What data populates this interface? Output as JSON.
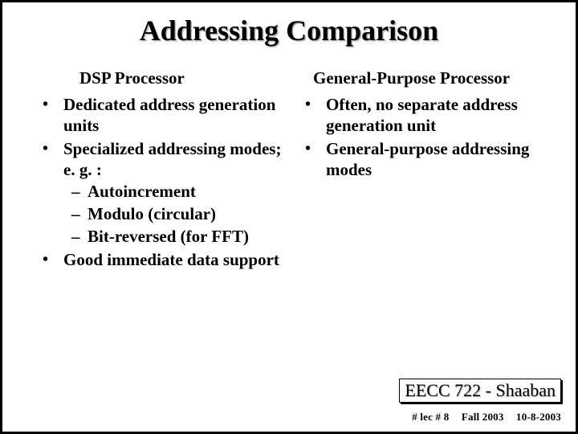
{
  "title": "Addressing Comparison",
  "left": {
    "heading": "DSP Processor",
    "items": {
      "0": "Dedicated address generation units",
      "1": "Specialized addressing modes; e. g. :",
      "1_sub": {
        "0": "Autoincrement",
        "1": "Modulo (circular)",
        "2": "Bit-reversed (for FFT)"
      },
      "2": "Good immediate data support"
    }
  },
  "right": {
    "heading": "General-Purpose Processor",
    "items": {
      "0": "Often, no separate address generation unit",
      "1": "General-purpose addressing modes"
    }
  },
  "footer": {
    "course": "EECC 722 - Shaaban",
    "lec": "#  lec # 8",
    "term": "Fall 2003",
    "date": "10-8-2003"
  }
}
